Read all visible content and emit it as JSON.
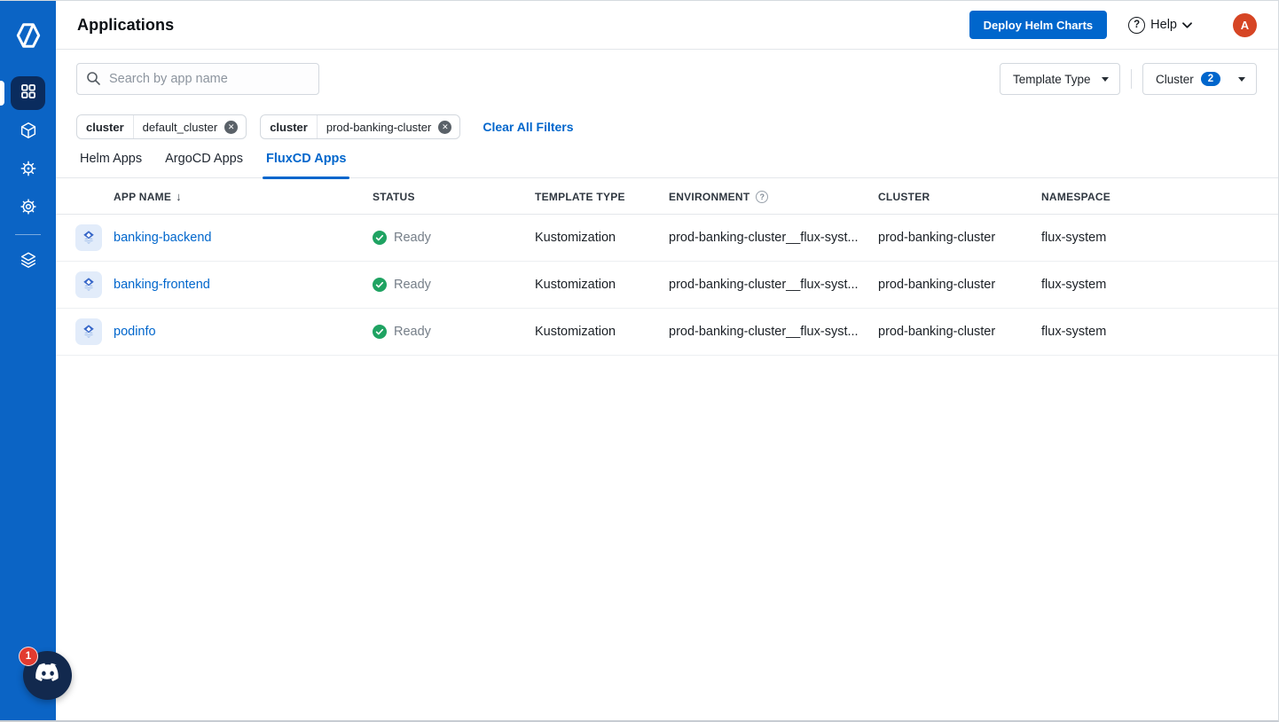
{
  "header": {
    "title": "Applications",
    "deploy_button": "Deploy Helm Charts",
    "help_label": "Help",
    "avatar_letter": "A"
  },
  "filters": {
    "search_placeholder": "Search by app name",
    "template_type_label": "Template Type",
    "cluster_label": "Cluster",
    "cluster_count": "2",
    "chips": [
      {
        "key": "cluster",
        "value": "default_cluster"
      },
      {
        "key": "cluster",
        "value": "prod-banking-cluster"
      }
    ],
    "clear_all": "Clear All Filters"
  },
  "tabs": [
    {
      "label": "Helm Apps",
      "active": false
    },
    {
      "label": "ArgoCD Apps",
      "active": false
    },
    {
      "label": "FluxCD Apps",
      "active": true
    }
  ],
  "table": {
    "columns": [
      "APP NAME",
      "STATUS",
      "TEMPLATE TYPE",
      "ENVIRONMENT",
      "CLUSTER",
      "NAMESPACE"
    ],
    "sort_column": "APP NAME",
    "sort_direction": "desc",
    "rows": [
      {
        "app_name": "banking-backend",
        "status": "Ready",
        "template_type": "Kustomization",
        "environment": "prod-banking-cluster__flux-syst...",
        "cluster": "prod-banking-cluster",
        "namespace": "flux-system"
      },
      {
        "app_name": "banking-frontend",
        "status": "Ready",
        "template_type": "Kustomization",
        "environment": "prod-banking-cluster__flux-syst...",
        "cluster": "prod-banking-cluster",
        "namespace": "flux-system"
      },
      {
        "app_name": "podinfo",
        "status": "Ready",
        "template_type": "Kustomization",
        "environment": "prod-banking-cluster__flux-syst...",
        "cluster": "prod-banking-cluster",
        "namespace": "flux-system"
      }
    ]
  },
  "sidebar": {
    "icons": [
      "devtron-logo-icon",
      "grid-icon",
      "cube-icon",
      "helm-wheel-icon",
      "gear-icon",
      "layers-icon",
      "discord-icon"
    ]
  },
  "widgets": {
    "chat_badge": "1"
  },
  "colors": {
    "accent": "#0066CC",
    "sidebar": "#0B64C5",
    "sidebar_active": "#0A2C5E",
    "status_ready": "#1FA362",
    "avatar": "#D64524",
    "notification_badge": "#E23B30",
    "discord_bg": "#12294E"
  }
}
